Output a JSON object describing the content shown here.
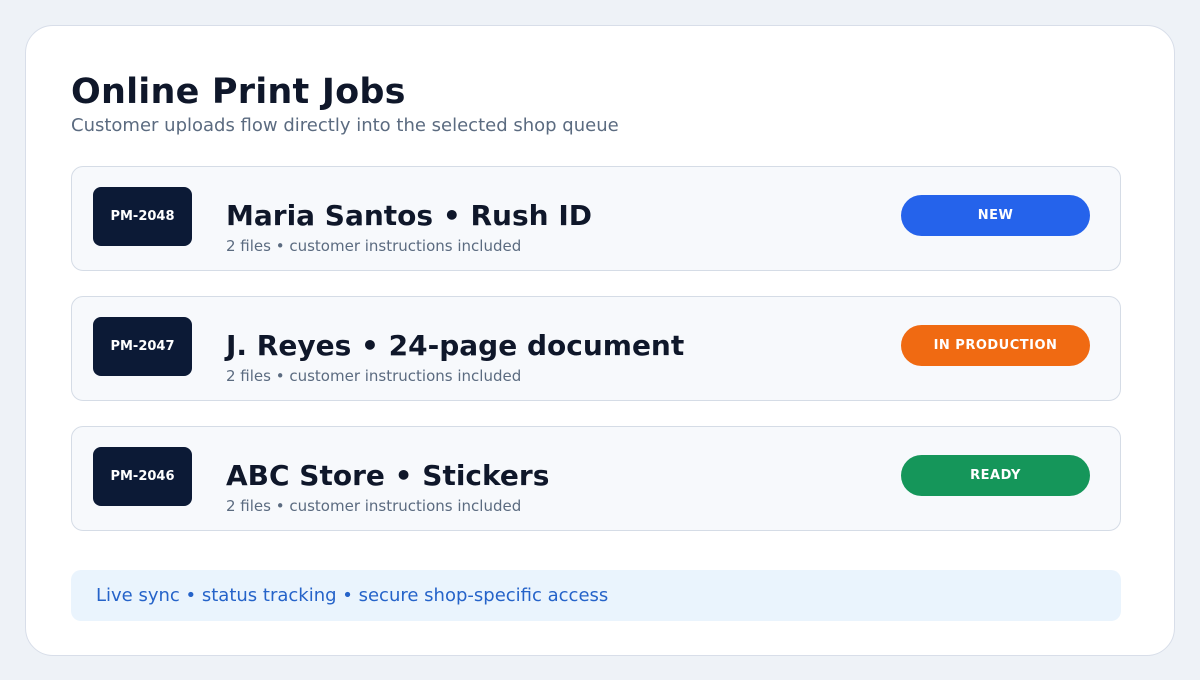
{
  "header": {
    "title": "Online Print Jobs",
    "subtitle": "Customer uploads flow directly into the selected shop queue"
  },
  "jobs": [
    {
      "id": "PM-2048",
      "title": "Maria Santos • Rush ID",
      "meta": "2 files • customer instructions included",
      "status": "NEW",
      "status_color": "#2563eb"
    },
    {
      "id": "PM-2047",
      "title": "J. Reyes • 24-page document",
      "meta": "2 files • customer instructions included",
      "status": "IN PRODUCTION",
      "status_color": "#f06a12"
    },
    {
      "id": "PM-2046",
      "title": "ABC Store • Stickers",
      "meta": "2 files • customer instructions included",
      "status": "READY",
      "status_color": "#15965a"
    }
  ],
  "footer": {
    "note": "Live sync • status tracking • secure shop-specific access"
  },
  "colors": {
    "id_badge": "#0c1a36",
    "footer_text": "#2563c9",
    "footer_bg": "#eaf4fd"
  }
}
